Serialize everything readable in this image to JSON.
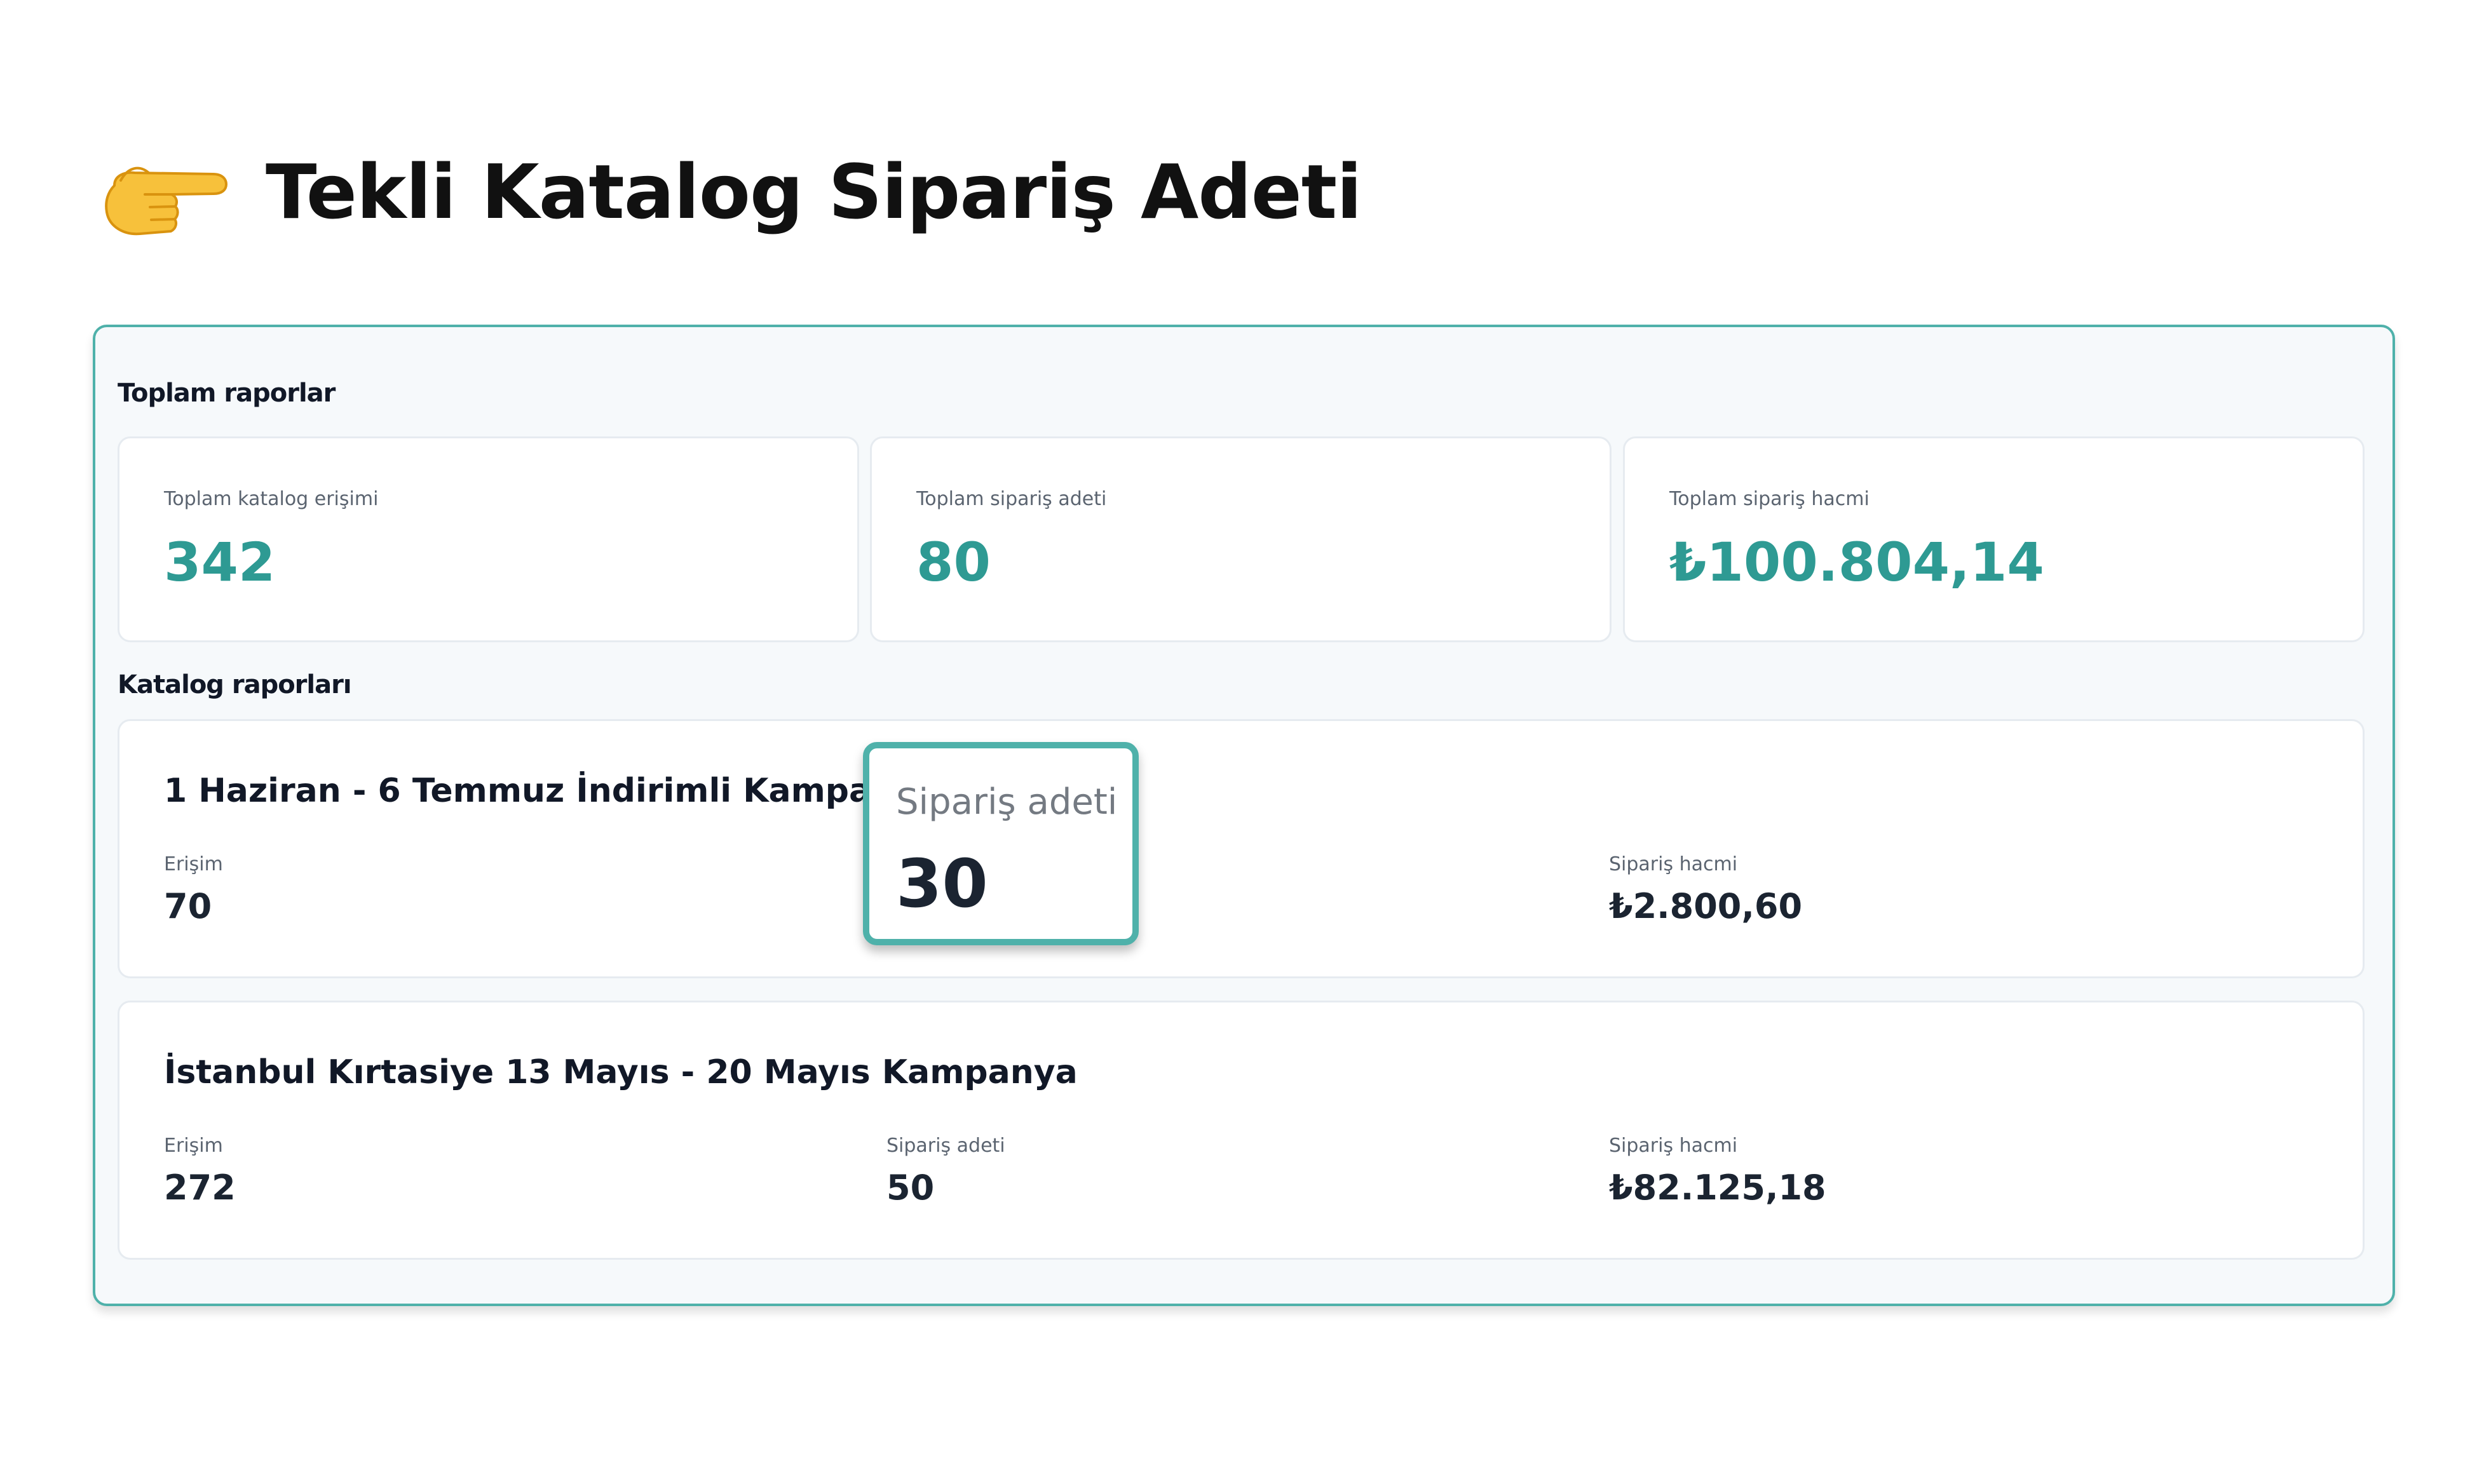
{
  "page": {
    "title": "Tekli Katalog Sipariş Adeti",
    "title_icon": "pointing-right-hand-emoji"
  },
  "colors": {
    "accent": "#2e9a93",
    "panel_border": "#4fb1aa",
    "panel_bg": "#f6f9fb"
  },
  "totals": {
    "section_title": "Toplam raporlar",
    "cards": [
      {
        "label": "Toplam katalog erişimi",
        "value": "342"
      },
      {
        "label": "Toplam sipariş adeti",
        "value": "80"
      },
      {
        "label": "Toplam sipariş hacmi",
        "value": "₺100.804,14"
      }
    ]
  },
  "catalogs": {
    "section_title": "Katalog raporları",
    "items": [
      {
        "title": "1 Haziran - 6 Temmuz İndirimli Kampanya",
        "reach_label": "Erişim",
        "reach": "70",
        "orders_label": "Sipariş adeti",
        "orders": "30",
        "volume_label": "Sipariş hacmi",
        "volume": "₺2.800,60"
      },
      {
        "title": "İstanbul Kırtasiye 13 Mayıs - 20 Mayıs Kampanya",
        "reach_label": "Erişim",
        "reach": "272",
        "orders_label": "Sipariş adeti",
        "orders": "50",
        "volume_label": "Sipariş hacmi",
        "volume": "₺82.125,18"
      }
    ]
  }
}
